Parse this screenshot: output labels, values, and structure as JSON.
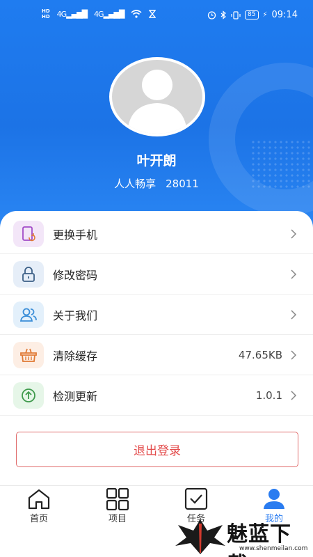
{
  "status_bar": {
    "network_type": "4G",
    "battery_level": "85",
    "time": "09:14"
  },
  "profile": {
    "name": "叶开朗",
    "company": "人人畅享",
    "user_id": "28011"
  },
  "menu": [
    {
      "label": "更换手机",
      "value": "",
      "icon": "change-phone-icon",
      "icon_bg": "#f3e6f8",
      "icon_color": "#a24cc7"
    },
    {
      "label": "修改密码",
      "value": "",
      "icon": "lock-icon",
      "icon_bg": "#e6eef8",
      "icon_color": "#3b5f86"
    },
    {
      "label": "关于我们",
      "value": "",
      "icon": "users-icon",
      "icon_bg": "#e3f0fb",
      "icon_color": "#3b8ed8"
    },
    {
      "label": "清除缓存",
      "value": "47.65KB",
      "icon": "basket-icon",
      "icon_bg": "#fdeee4",
      "icon_color": "#e07a35"
    },
    {
      "label": "检测更新",
      "value": "1.0.1",
      "icon": "upload-icon",
      "icon_bg": "#e6f6e8",
      "icon_color": "#3f9a4c"
    }
  ],
  "logout_label": "退出登录",
  "tabs": [
    {
      "label": "首页",
      "icon": "home-icon",
      "active": false
    },
    {
      "label": "项目",
      "icon": "grid-icon",
      "active": false
    },
    {
      "label": "任务",
      "icon": "task-check-icon",
      "active": false
    },
    {
      "label": "我的",
      "icon": "profile-icon",
      "active": true
    }
  ],
  "colors": {
    "header_blue": "#1f7cf0",
    "accent_blue": "#2a7cf0",
    "logout_red": "#e34b4b"
  },
  "watermark": {
    "title": "魅蓝下载",
    "url": "www.shenmeilan.com"
  }
}
